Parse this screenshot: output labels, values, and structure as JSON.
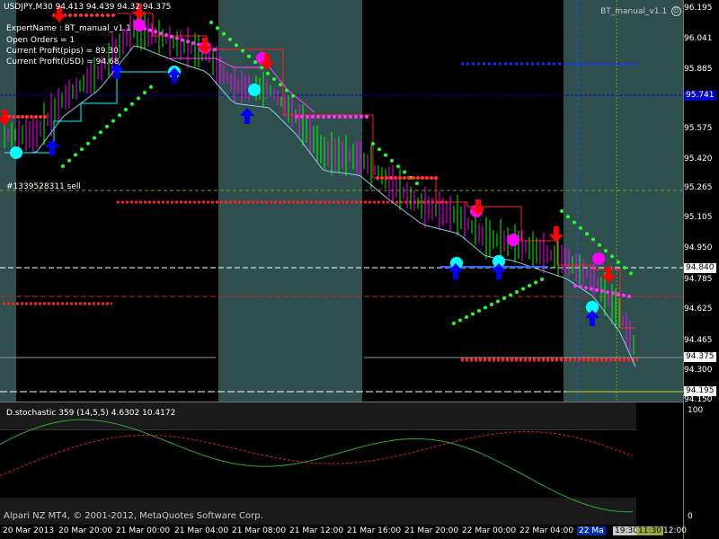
{
  "header": {
    "symbol": "USDJPY,M30",
    "ohlc": "94.413 94.439 94.32 94.375",
    "indicator_name": "BT_manual_v1.1"
  },
  "info_panel": [
    "ExpertName : BT_manual_v1.1",
    "Open Orders = 1",
    "Current Profit(pips) = 89.30",
    "Current Profit(USD) = 94.68"
  ],
  "order_label": "#1339528311 sell",
  "price_axis": [
    "96.195",
    "96.041",
    "95.885",
    "95.730",
    "95.575",
    "95.420",
    "95.265",
    "95.105",
    "94.950",
    "94.785",
    "94.625",
    "94.465",
    "94.300",
    "94.150"
  ],
  "price_boxes": {
    "blue_line": "95.741",
    "white_line": "94.840",
    "current": "94.375",
    "bottom": "94.195"
  },
  "colors": {
    "background": "#000000",
    "shade": "#2f4f4f",
    "bull": "#00ff00",
    "bear": "#ff00ff",
    "buy_arrow": "#0000ff",
    "sell_arrow": "#ff0000",
    "ma": "#87ceeb",
    "stoch_main": "#2faa2f",
    "stoch_signal": "#dd2222"
  },
  "stochastic": {
    "header": "D.stochastic 359 (14,5,5) 4.6302 10.4172",
    "axis": [
      "100",
      "0"
    ]
  },
  "copyright": "Alpari NZ MT4, © 2001-2012, MetaQuotes Software Corp.",
  "time_axis": [
    "20 Mar 2013",
    "20 Mar 20:00",
    "21 Mar 00:00",
    "21 Mar 04:00",
    "21 Mar 08:00",
    "21 Mar 12:00",
    "21 Mar 16:00",
    "21 Mar 20:00",
    "22 Mar 00:00",
    "22 Mar 04:00",
    "22 Ma",
    "19:30",
    "11:30",
    "12:00"
  ]
}
